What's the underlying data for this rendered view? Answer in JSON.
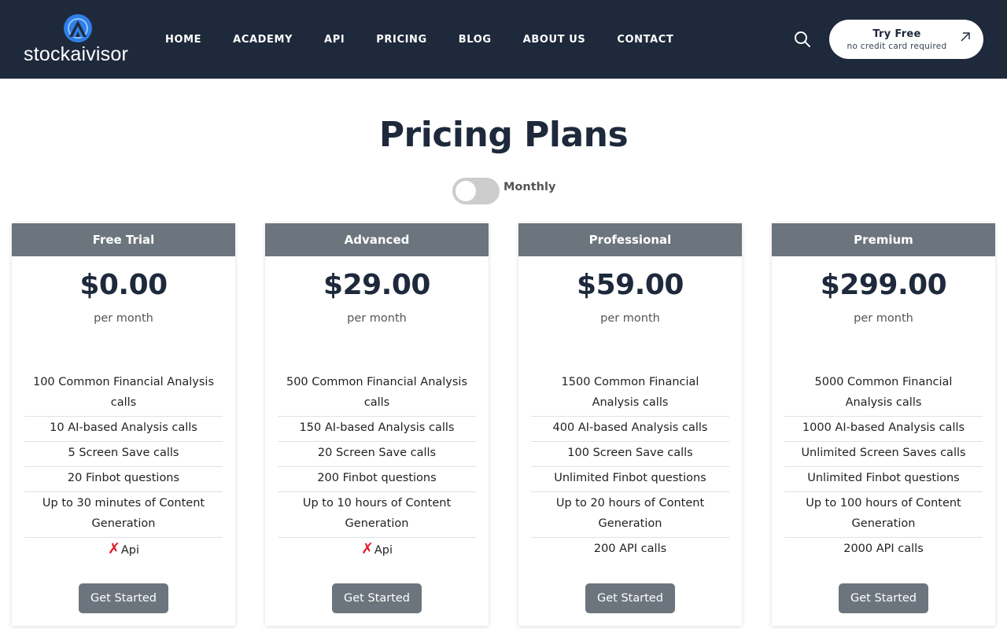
{
  "header": {
    "brand": "stockaivisor",
    "nav": [
      "HOME",
      "ACADEMY",
      "API",
      "PRICING",
      "BLOG",
      "ABOUT US",
      "CONTACT"
    ],
    "try_free": {
      "title": "Try Free",
      "subtitle": "no credit card required"
    },
    "colors": {
      "background": "#1e293b",
      "logo_blue": "#2f7fe6"
    }
  },
  "pricing": {
    "title": "Pricing Plans",
    "billing_toggle_label": "Monthly",
    "plans": [
      {
        "name": "Free Trial",
        "price": "$0.00",
        "period": "per month",
        "features": [
          "100 Common Financial Analysis calls",
          "10 AI-based Analysis calls",
          "5 Screen Save calls",
          "20 Finbot questions",
          "Up to 30 minutes of Content Generation",
          "Api"
        ],
        "api_included": false,
        "cta": "Get Started"
      },
      {
        "name": "Advanced",
        "price": "$29.00",
        "period": "per month",
        "features": [
          "500 Common Financial Analysis calls",
          "150 AI-based Analysis calls",
          "20 Screen Save calls",
          "200 Finbot questions",
          "Up to 10 hours of Content Generation",
          "Api"
        ],
        "api_included": false,
        "cta": "Get Started"
      },
      {
        "name": "Professional",
        "price": "$59.00",
        "period": "per month",
        "features": [
          "1500 Common Financial Analysis calls",
          "400 AI-based Analysis calls",
          "100 Screen Save calls",
          "Unlimited Finbot questions",
          "Up to 20 hours of Content Generation",
          "200 API calls"
        ],
        "api_included": true,
        "cta": "Get Started"
      },
      {
        "name": "Premium",
        "price": "$299.00",
        "period": "per month",
        "features": [
          "5000 Common Financial Analysis calls",
          "1000 AI-based Analysis calls",
          "Unlimited Screen Saves calls",
          "Unlimited Finbot questions",
          "Up to 100 hours of Content Generation",
          "2000 API calls"
        ],
        "api_included": true,
        "cta": "Get Started"
      }
    ],
    "colors": {
      "plan_header": "#6c757d",
      "button": "#6c757d",
      "cross_mark": "#e11d2a"
    }
  }
}
